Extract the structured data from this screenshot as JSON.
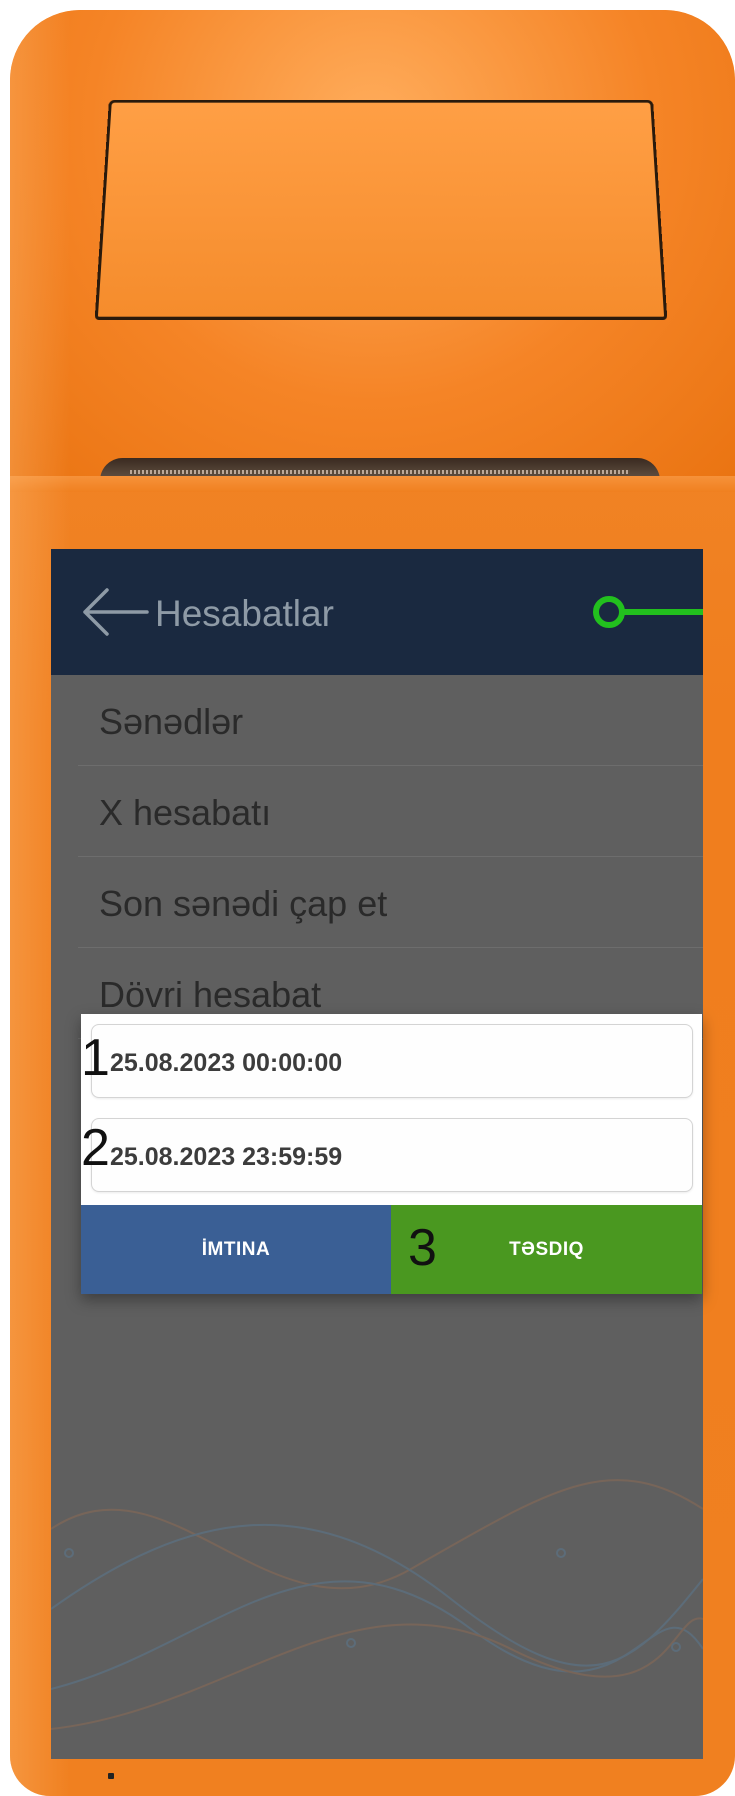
{
  "appbar": {
    "title": "Hesabatlar"
  },
  "menu": {
    "items": [
      {
        "label": "Sənədlər"
      },
      {
        "label": "X hesabatı"
      },
      {
        "label": "Son sənədi çap et"
      },
      {
        "label": "Dövri hesabat"
      }
    ]
  },
  "dialog": {
    "start_date": "25.08.2023 00:00:00",
    "end_date": "25.08.2023 23:59:59",
    "cancel_label": "İMTINA",
    "confirm_label": "TƏSDIQ"
  },
  "annotations": {
    "n1": "1",
    "n2": "2",
    "n3": "3"
  },
  "colors": {
    "device": "#f08020",
    "appbar": "#1a2940",
    "cancel": "#3a5f95",
    "confirm": "#4a9820",
    "marker": "#22c01e"
  },
  "icons": {
    "back": "arrow-left-icon",
    "marker": "green-pointer-icon"
  }
}
